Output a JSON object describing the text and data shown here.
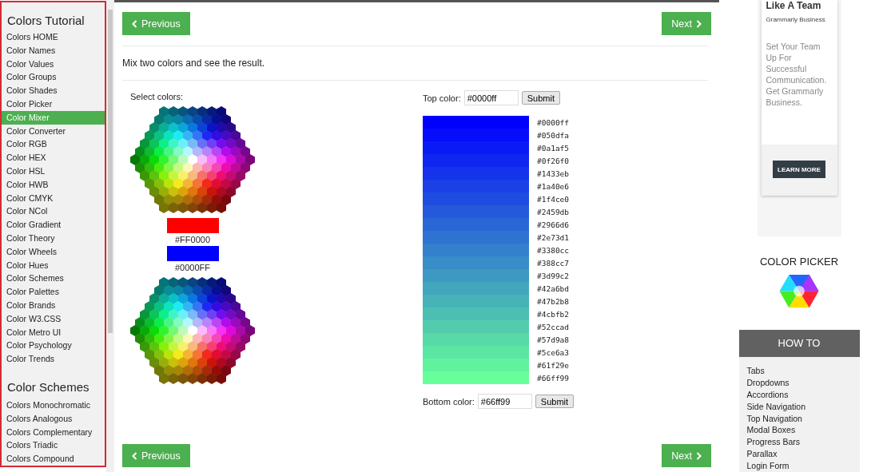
{
  "sidebar": {
    "sections": [
      {
        "title": "Colors Tutorial",
        "items": [
          {
            "label": "Colors HOME",
            "selected": false
          },
          {
            "label": "Color Names",
            "selected": false
          },
          {
            "label": "Color Values",
            "selected": false
          },
          {
            "label": "Color Groups",
            "selected": false
          },
          {
            "label": "Color Shades",
            "selected": false
          },
          {
            "label": "Color Picker",
            "selected": false
          },
          {
            "label": "Color Mixer",
            "selected": true
          },
          {
            "label": "Color Converter",
            "selected": false
          },
          {
            "label": "Color RGB",
            "selected": false
          },
          {
            "label": "Color HEX",
            "selected": false
          },
          {
            "label": "Color HSL",
            "selected": false
          },
          {
            "label": "Color HWB",
            "selected": false
          },
          {
            "label": "Color CMYK",
            "selected": false
          },
          {
            "label": "Color NCol",
            "selected": false
          },
          {
            "label": "Color Gradient",
            "selected": false
          },
          {
            "label": "Color Theory",
            "selected": false
          },
          {
            "label": "Color Wheels",
            "selected": false
          },
          {
            "label": "Color Hues",
            "selected": false
          },
          {
            "label": "Color Schemes",
            "selected": false
          },
          {
            "label": "Color Palettes",
            "selected": false
          },
          {
            "label": "Color Brands",
            "selected": false
          },
          {
            "label": "Color W3.CSS",
            "selected": false
          },
          {
            "label": "Color Metro UI",
            "selected": false
          },
          {
            "label": "Color Psychology",
            "selected": false
          },
          {
            "label": "Color Trends",
            "selected": false
          }
        ]
      },
      {
        "title": "Color Schemes",
        "items": [
          {
            "label": "Colors Monochromatic",
            "selected": false
          },
          {
            "label": "Colors Analogous",
            "selected": false
          },
          {
            "label": "Colors Complementary",
            "selected": false
          },
          {
            "label": "Colors Triadic",
            "selected": false
          },
          {
            "label": "Colors Compound",
            "selected": false
          }
        ]
      }
    ]
  },
  "top_nav": {
    "previous": "Previous",
    "next": "Next"
  },
  "intro": "Mix two colors and see the result.",
  "mixer": {
    "select_label": "Select colors:",
    "swatches": [
      {
        "label": "#FF0000",
        "color": "#ff0000"
      },
      {
        "label": "#0000FF",
        "color": "#0000ff"
      }
    ],
    "top": {
      "label": "Top color:",
      "value": "#0000ff",
      "button": "Submit"
    },
    "steps": [
      {
        "label": "#0000ff",
        "color": "#0000ff"
      },
      {
        "label": "#050dfa",
        "color": "#050dfa"
      },
      {
        "label": "#0a1af5",
        "color": "#0a1af5"
      },
      {
        "label": "#0f26f0",
        "color": "#0f26f0"
      },
      {
        "label": "#1433eb",
        "color": "#1433eb"
      },
      {
        "label": "#1a40e6",
        "color": "#1a40e6"
      },
      {
        "label": "#1f4ce0",
        "color": "#1f4ce0"
      },
      {
        "label": "#2459db",
        "color": "#2459db"
      },
      {
        "label": "#2966d6",
        "color": "#2966d6"
      },
      {
        "label": "#2e73d1",
        "color": "#2e73d1"
      },
      {
        "label": "#3380cc",
        "color": "#3380cc"
      },
      {
        "label": "#388cc7",
        "color": "#388cc7"
      },
      {
        "label": "#3d99c2",
        "color": "#3d99c2"
      },
      {
        "label": "#42a6bd",
        "color": "#42a6bd"
      },
      {
        "label": "#47b2b8",
        "color": "#47b2b8"
      },
      {
        "label": "#4cbfb2",
        "color": "#4cbfb2"
      },
      {
        "label": "#52ccad",
        "color": "#52ccad"
      },
      {
        "label": "#57d9a8",
        "color": "#57d9a8"
      },
      {
        "label": "#5ce6a3",
        "color": "#5ce6a3"
      },
      {
        "label": "#61f29e",
        "color": "#61f29e"
      },
      {
        "label": "#66ff99",
        "color": "#66ff99"
      }
    ],
    "bottom": {
      "label": "Bottom color:",
      "value": "#66ff99",
      "button": "Submit"
    }
  },
  "bottom_nav": {
    "previous": "Previous",
    "next": "Next"
  },
  "ad": {
    "headline": "Like A Team",
    "brand": "Grammarly Business",
    "body": "Set Your Team Up For Successful Communication. Get Grammarly Business.",
    "button": "LEARN MORE"
  },
  "color_picker": {
    "title": "COLOR PICKER"
  },
  "how_to": {
    "title": "HOW TO",
    "items": [
      "Tabs",
      "Dropdowns",
      "Accordions",
      "Side Navigation",
      "Top Navigation",
      "Modal Boxes",
      "Progress Bars",
      "Parallax",
      "Login Form"
    ]
  }
}
